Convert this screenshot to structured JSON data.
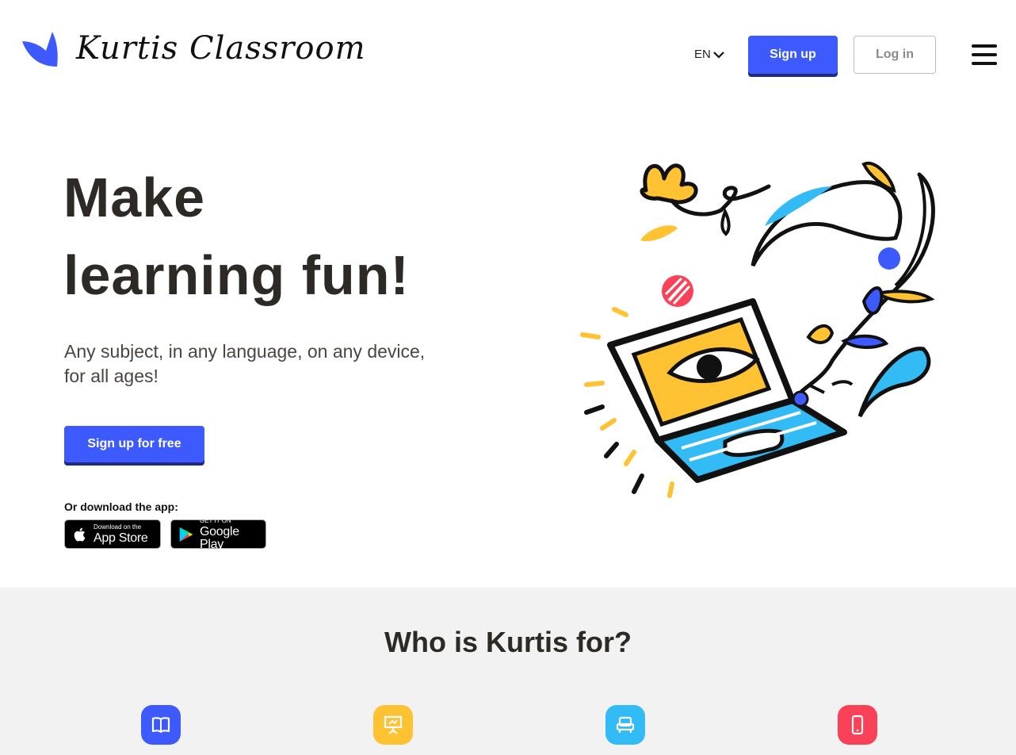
{
  "header": {
    "logo_text": "Kurtis Classroom",
    "language": "EN",
    "signup_label": "Sign up",
    "login_label": "Log in"
  },
  "hero": {
    "title_line1": "Make",
    "title_line2": "learning fun!",
    "subtitle": "Any subject, in any language, on any device, for all ages!",
    "cta_label": "Sign up for free",
    "download_label": "Or download the app:",
    "app_store": {
      "small": "Download on the",
      "big": "App Store"
    },
    "google_play": {
      "small": "GET IT ON",
      "big": "Google Play"
    }
  },
  "who": {
    "title": "Who is Kurtis for?",
    "icons": [
      {
        "name": "book-icon",
        "color": "#3d5afe"
      },
      {
        "name": "presentation-icon",
        "color": "#ffc233"
      },
      {
        "name": "armchair-icon",
        "color": "#33bbf5"
      },
      {
        "name": "smartphone-icon",
        "color": "#f94257"
      }
    ]
  },
  "colors": {
    "primary": "#3d5afe",
    "yellow": "#ffc233",
    "sky": "#33bbf5",
    "red": "#f94257"
  }
}
